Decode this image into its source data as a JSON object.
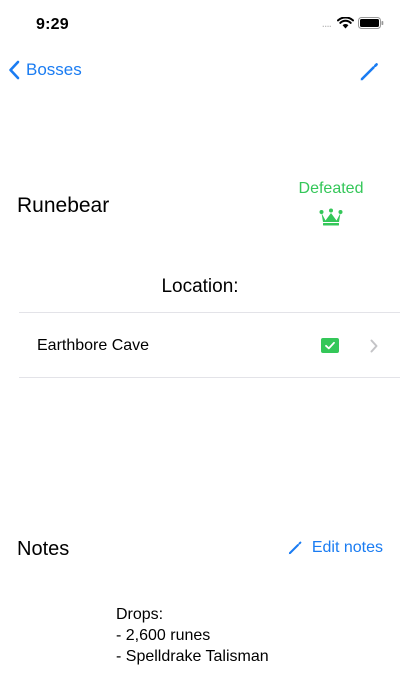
{
  "status_bar": {
    "time": "9:29",
    "signal_dots": "....",
    "icons": [
      "signal-icon",
      "wifi-icon",
      "battery-icon"
    ]
  },
  "nav": {
    "back_label": "Bosses",
    "back_icon": "chevron-left-icon",
    "edit_icon": "pencil-icon"
  },
  "boss": {
    "name": "Runebear",
    "status": "Defeated",
    "status_icon": "crown-icon"
  },
  "location": {
    "heading": "Location:",
    "items": [
      {
        "name": "Earthbore Cave",
        "checked": true,
        "checkmark": "✓"
      }
    ]
  },
  "notes": {
    "heading": "Notes",
    "edit_label": "Edit notes",
    "edit_icon": "pencil-icon",
    "lines": [
      "Drops:",
      "- 2,600 runes",
      "- Spelldrake Talisman"
    ]
  },
  "colors": {
    "accent": "#1a7cf2",
    "success": "#34c759",
    "divider": "#e3e3e8",
    "chevron": "#c4c4c7"
  }
}
